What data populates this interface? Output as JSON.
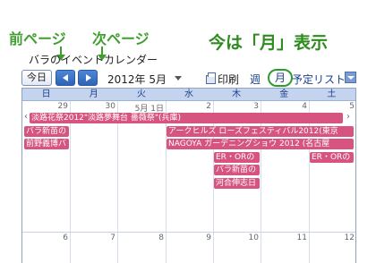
{
  "annotations": {
    "prev_page": "前ページ",
    "next_page": "次ページ",
    "current_view": "今は「月」表示"
  },
  "calendar_title": "バラのイベントカレンダー",
  "toolbar": {
    "today": "今日",
    "date": "2012年 5月",
    "print": "印刷",
    "week": "週",
    "month": "月",
    "agenda": "予定リスト"
  },
  "weekdays": [
    "日",
    "月",
    "火",
    "水",
    "木",
    "金",
    "土"
  ],
  "week1": {
    "dates": [
      "29",
      "30",
      "5月 1日",
      "2",
      "3",
      "4",
      "5"
    ],
    "events": [
      "淡路花祭2012\"淡路夢舞台 薔薇祭\"(兵庫)",
      "バラ新苗の",
      "アークヒルズ ローズフェスティバル2012(東京",
      "前野義博バ",
      "NAGOYA ガーデニングショウ 2012 (名古屋",
      "ER・ORの",
      "ER・ORの",
      "バラ新苗の",
      "河合伸志日"
    ]
  },
  "week2": {
    "dates": [
      "6",
      "7",
      "8",
      "9",
      "10",
      "11",
      "12"
    ]
  },
  "colors": {
    "event": "#d6547f",
    "annotation": "#3f9f2e",
    "header": "#c4d3ee"
  }
}
